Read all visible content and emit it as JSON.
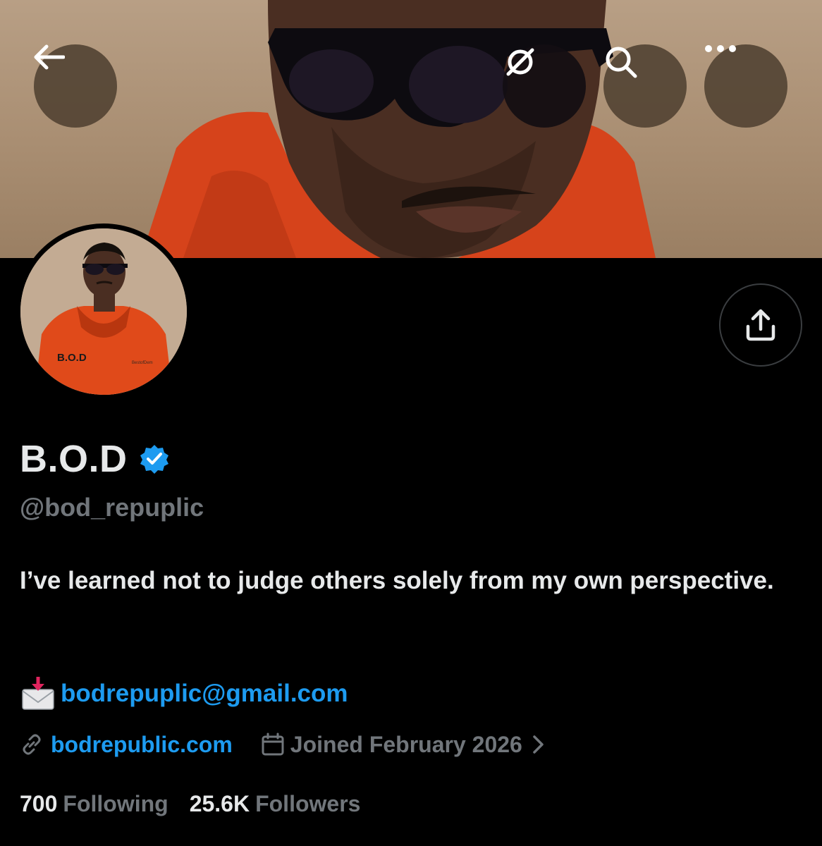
{
  "header": {
    "back_icon": "arrow-left-icon",
    "grok_icon": "grok-icon",
    "search_icon": "search-icon",
    "more_icon": "more-horizontal-icon"
  },
  "profile": {
    "display_name": "B.O.D",
    "verified": true,
    "handle": "@bod_repuplic",
    "bio": "I’ve learned not to judge others solely from my own perspective.",
    "email": "bodrepuplic@gmail.com",
    "website": "bodrepublic.com",
    "joined": "Joined February 2026",
    "avatar_hoodie_text": "B.O.D",
    "avatar_hoodie_subtext": "BestofDem"
  },
  "stats": {
    "following_count": "700",
    "following_label": "Following",
    "followers_count": "25.6K",
    "followers_label": "Followers"
  },
  "colors": {
    "link_blue": "#1d9bf0",
    "muted_gray": "#71767b",
    "text": "#e7e9ea",
    "verified_blue": "#1d9bf0",
    "hoodie_orange": "#d9461d"
  }
}
